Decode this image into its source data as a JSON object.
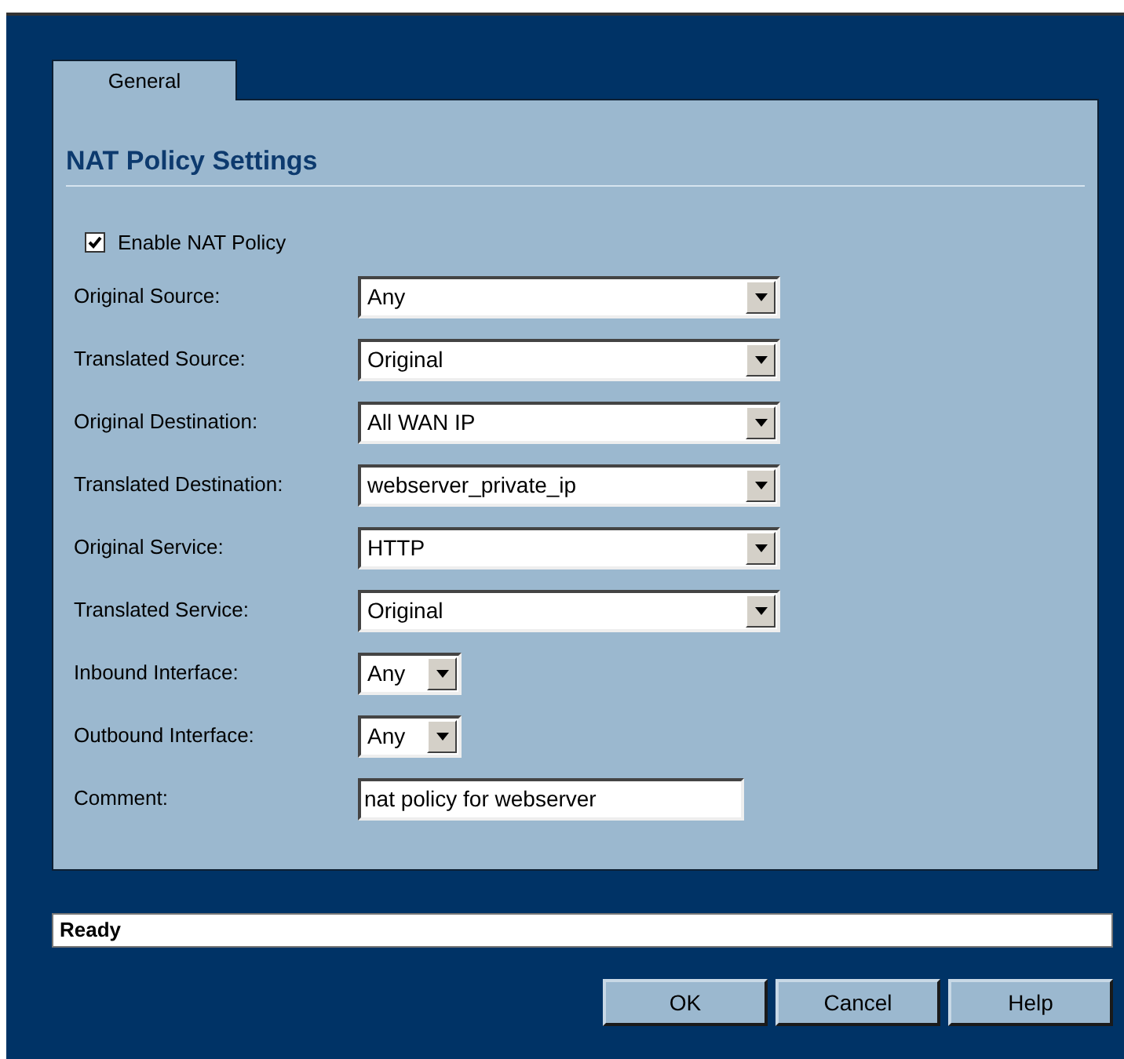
{
  "tabs": [
    {
      "label": "General",
      "selected": true
    }
  ],
  "section_title": "NAT Policy Settings",
  "enable": {
    "label": "Enable NAT Policy",
    "checked": true
  },
  "fields": [
    {
      "kind": "select",
      "label": "Original Source:",
      "value": "Any"
    },
    {
      "kind": "select",
      "label": "Translated Source:",
      "value": "Original"
    },
    {
      "kind": "select",
      "label": "Original Destination:",
      "value": "All WAN IP"
    },
    {
      "kind": "select",
      "label": "Translated Destination:",
      "value": "webserver_private_ip"
    },
    {
      "kind": "select",
      "label": "Original Service:",
      "value": "HTTP"
    },
    {
      "kind": "select",
      "label": "Translated Service:",
      "value": "Original"
    },
    {
      "kind": "compact",
      "label": "Inbound Interface:",
      "value": "Any"
    },
    {
      "kind": "compact",
      "label": "Outbound Interface:",
      "value": "Any"
    },
    {
      "kind": "text",
      "label": "Comment:",
      "value": "nat policy for webserver"
    }
  ],
  "status_bar": "Ready",
  "buttons": [
    "OK",
    "Cancel",
    "Help"
  ]
}
